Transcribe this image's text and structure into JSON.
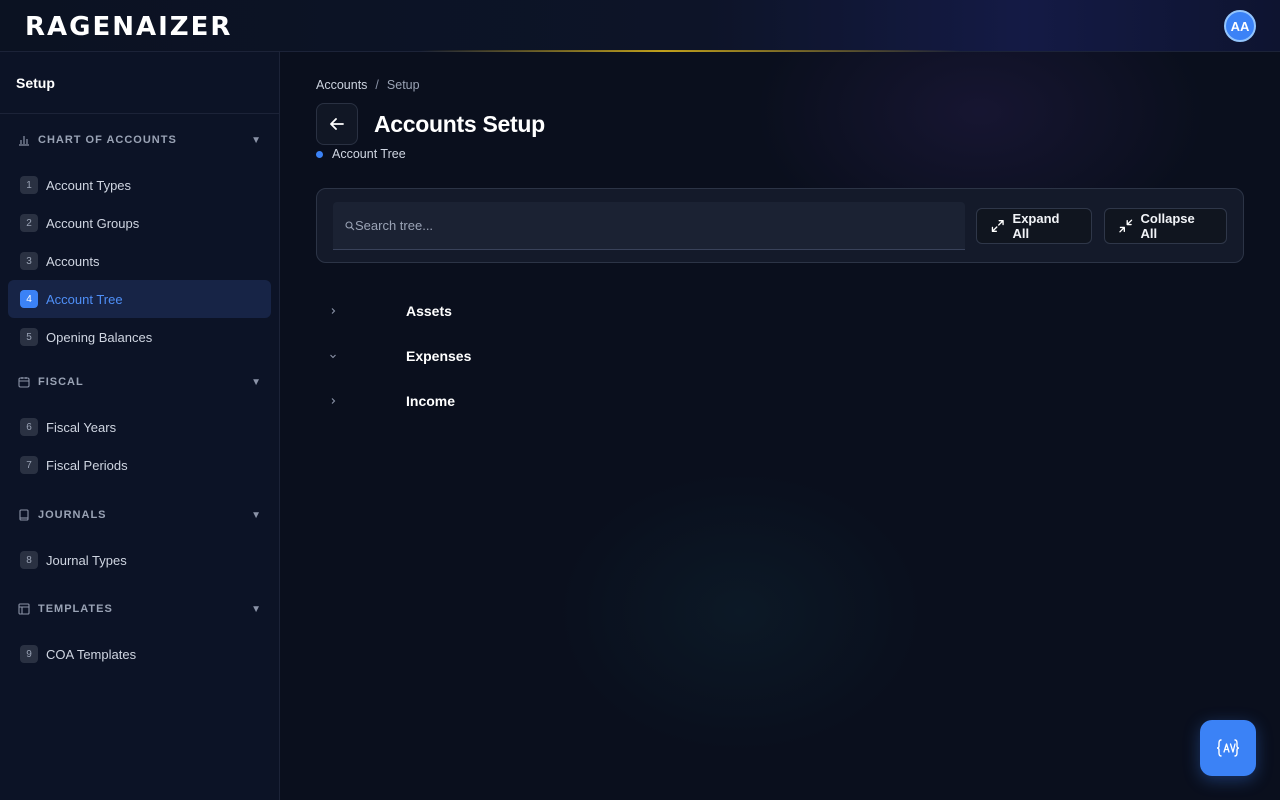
{
  "app": {
    "logo": "RAGENAIZER",
    "user_initials": "AA"
  },
  "sidebar": {
    "title": "Setup",
    "sections": [
      {
        "title": "CHART OF ACCOUNTS",
        "icon": "bar-chart-icon",
        "items": [
          {
            "num": "1",
            "label": "Account Types"
          },
          {
            "num": "2",
            "label": "Account Groups"
          },
          {
            "num": "3",
            "label": "Accounts"
          },
          {
            "num": "4",
            "label": "Account Tree",
            "active": true
          },
          {
            "num": "5",
            "label": "Opening Balances"
          }
        ]
      },
      {
        "title": "FISCAL",
        "icon": "calendar-icon",
        "items": [
          {
            "num": "6",
            "label": "Fiscal Years"
          },
          {
            "num": "7",
            "label": "Fiscal Periods"
          }
        ]
      },
      {
        "title": "JOURNALS",
        "icon": "book-icon",
        "items": [
          {
            "num": "8",
            "label": "Journal Types"
          }
        ]
      },
      {
        "title": "TEMPLATES",
        "icon": "layout-icon",
        "items": [
          {
            "num": "9",
            "label": "COA Templates"
          }
        ]
      }
    ]
  },
  "main": {
    "breadcrumb": {
      "root": "Accounts",
      "separator": "/",
      "current": "Setup"
    },
    "title": "Accounts Setup",
    "subtitle": "Account Tree",
    "search": {
      "placeholder": "Search tree...",
      "value": ""
    },
    "buttons": {
      "expand_all": "Expand All",
      "collapse_all": "Collapse All"
    },
    "tree": [
      {
        "label": "Assets",
        "state": "collapsed"
      },
      {
        "label": "Expenses",
        "state": "expanded"
      },
      {
        "label": "Income",
        "state": "collapsed"
      }
    ]
  },
  "colors": {
    "accent": "#3b82f6",
    "background": "#0a0f1d",
    "sidebar": "#0c1326"
  }
}
